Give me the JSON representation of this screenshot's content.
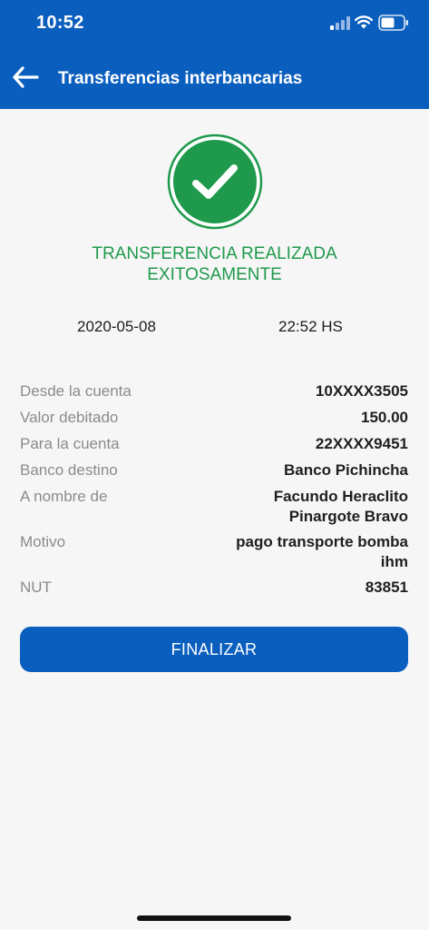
{
  "status_bar": {
    "time": "10:52",
    "icons": [
      "cellular-signal-icon",
      "wifi-icon",
      "battery-icon"
    ]
  },
  "header": {
    "title": "Transferencias interbancarias",
    "back_icon": "arrow-left-icon"
  },
  "result": {
    "icon": "checkmark-circle-icon",
    "message_line1": "TRANSFERENCIA REALIZADA",
    "message_line2": "EXITOSAMENTE",
    "date": "2020-05-08",
    "time": "22:52 HS"
  },
  "details": [
    {
      "label": "Desde la cuenta",
      "value": "10XXXX3505"
    },
    {
      "label": "Valor debitado",
      "value": "150.00"
    },
    {
      "label": "Para la cuenta",
      "value": "22XXXX9451"
    },
    {
      "label": "Banco destino",
      "value": "Banco Pichincha"
    },
    {
      "label": "A nombre de",
      "value_line1": "Facundo Heraclito",
      "value_line2": "Pinargote Bravo"
    },
    {
      "label": "Motivo",
      "value_line1": "pago transporte bomba",
      "value_line2": "ihm"
    },
    {
      "label": "NUT",
      "value": "83851"
    }
  ],
  "actions": {
    "finalize_label": "FINALIZAR"
  },
  "colors": {
    "primary": "#0a5ebe",
    "success": "#1f9a4c",
    "background": "#f6f6f6"
  }
}
